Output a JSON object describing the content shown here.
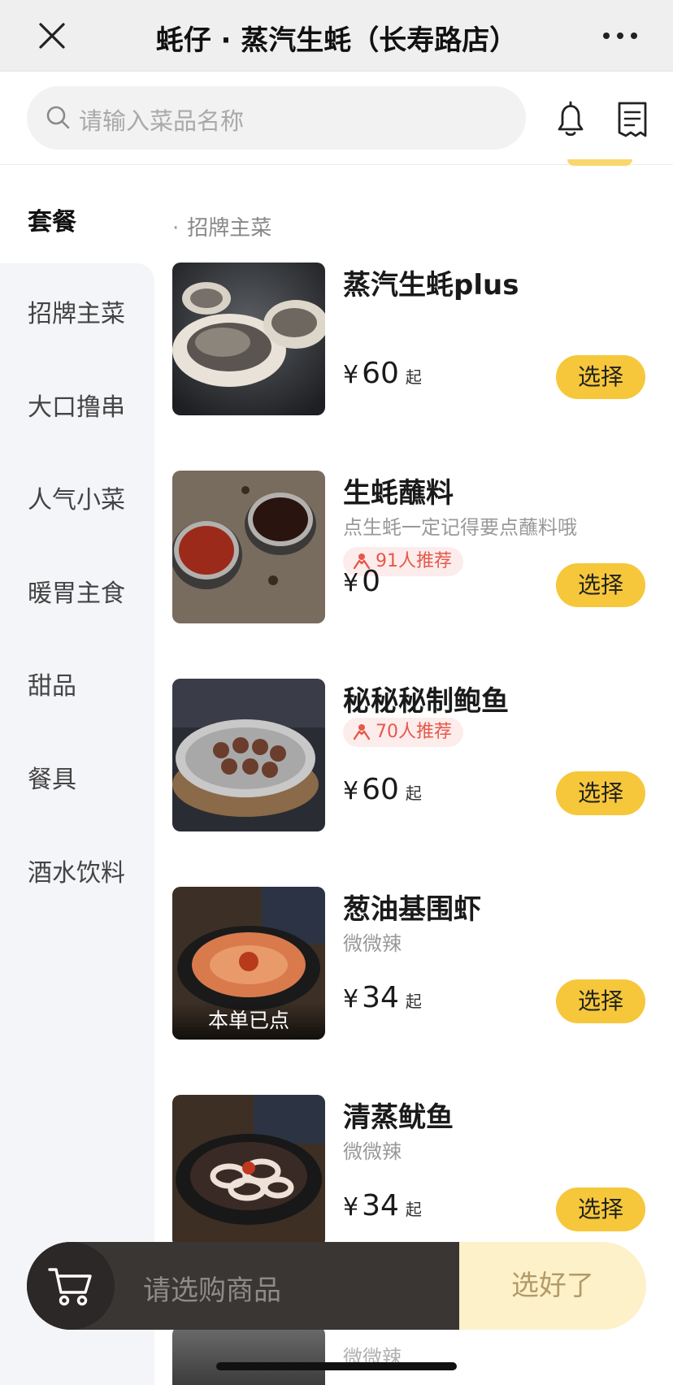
{
  "topbar": {
    "title": "蚝仔 · 蒸汽生蚝（长寿路店）",
    "close_icon": "close-icon",
    "more_icon": "more-icon"
  },
  "search": {
    "placeholder": "请输入菜品名称",
    "icons": [
      "search-icon",
      "bell-icon",
      "receipt-icon"
    ]
  },
  "sidebar": {
    "items": [
      {
        "label": "套餐"
      },
      {
        "label": "招牌主菜"
      },
      {
        "label": "大口撸串"
      },
      {
        "label": "人气小菜"
      },
      {
        "label": "暖胃主食"
      },
      {
        "label": "甜品"
      },
      {
        "label": "餐具"
      },
      {
        "label": "酒水饮料"
      }
    ],
    "active": "套餐"
  },
  "menu": {
    "section": "招牌主菜",
    "items": [
      {
        "name": "蒸汽生蚝plus",
        "desc": "",
        "recommend": "",
        "currency": "¥",
        "price": "60",
        "suffix": "起",
        "button": "选择",
        "badge": ""
      },
      {
        "name": "生蚝蘸料",
        "desc": "点生蚝一定记得要点蘸料哦",
        "recommend": "91人推荐",
        "currency": "¥",
        "price": "0",
        "suffix": "",
        "button": "选择",
        "badge": ""
      },
      {
        "name": "秘秘秘制鲍鱼",
        "desc": "",
        "recommend": "70人推荐",
        "currency": "¥",
        "price": "60",
        "suffix": "起",
        "button": "选择",
        "badge": ""
      },
      {
        "name": "葱油基围虾",
        "desc": "微微辣",
        "recommend": "",
        "currency": "¥",
        "price": "34",
        "suffix": "起",
        "button": "选择",
        "badge": "本单已点"
      },
      {
        "name": "清蒸鱿鱼",
        "desc": "微微辣",
        "recommend": "",
        "currency": "¥",
        "price": "34",
        "suffix": "起",
        "button": "选择",
        "badge": ""
      }
    ],
    "partial_desc": "微微辣"
  },
  "cart": {
    "placeholder": "请选购商品",
    "submit": "选好了",
    "icon": "cart-icon"
  },
  "colors": {
    "accent_yellow": "#f6c73a",
    "cart_dark": "#3a3634",
    "cart_light": "#fdf1c9",
    "recommend_red": "#e5584a"
  }
}
